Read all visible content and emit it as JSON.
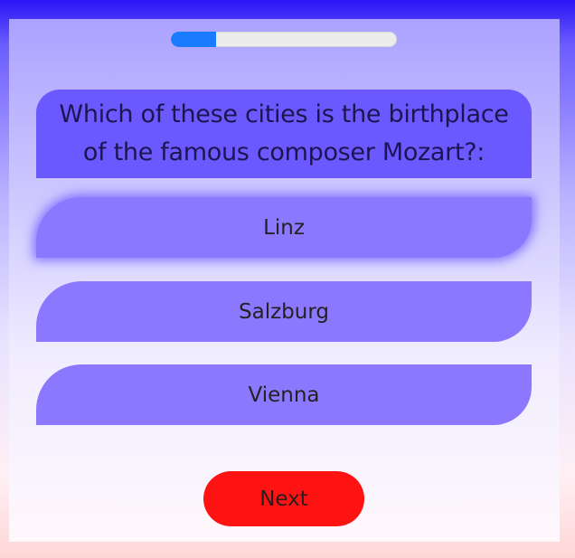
{
  "progress": {
    "value_fraction": 0.2,
    "fill_color": "#1a7bff"
  },
  "question": {
    "text": "Which of these cities is the birthplace of the famous composer Mozart?:"
  },
  "options": [
    {
      "label": "Linz",
      "selected": true
    },
    {
      "label": "Salzburg",
      "selected": false
    },
    {
      "label": "Vienna",
      "selected": false
    }
  ],
  "next_button": {
    "label": "Next",
    "color": "#ff1212"
  },
  "colors": {
    "question_bg": "#6a59ff",
    "option_bg": "#8b78ff"
  }
}
